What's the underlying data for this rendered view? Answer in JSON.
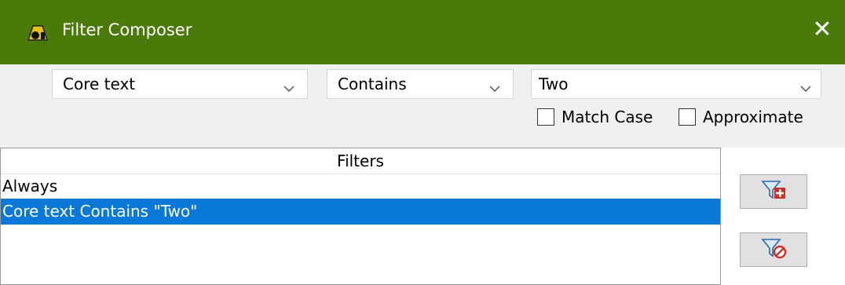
{
  "window": {
    "title": "Filter Composer",
    "close_label": "✕"
  },
  "composer": {
    "field": {
      "value": "Core text"
    },
    "operator": {
      "value": "Contains"
    },
    "term": {
      "value": "Two"
    },
    "options": [
      {
        "label": "Match Case",
        "checked": false
      },
      {
        "label": "Approximate",
        "checked": false
      }
    ]
  },
  "filters": {
    "header": "Filters",
    "items": [
      {
        "label": "Always",
        "selected": false
      },
      {
        "label": "Core text Contains \"Two\"",
        "selected": true
      }
    ]
  },
  "colors": {
    "titlebar": "#4b7a0a",
    "selection": "#0a78d7",
    "panel": "#f0f0f0"
  },
  "icons": {
    "add_filter": "funnel-plus-icon",
    "remove_filter": "funnel-remove-icon"
  }
}
